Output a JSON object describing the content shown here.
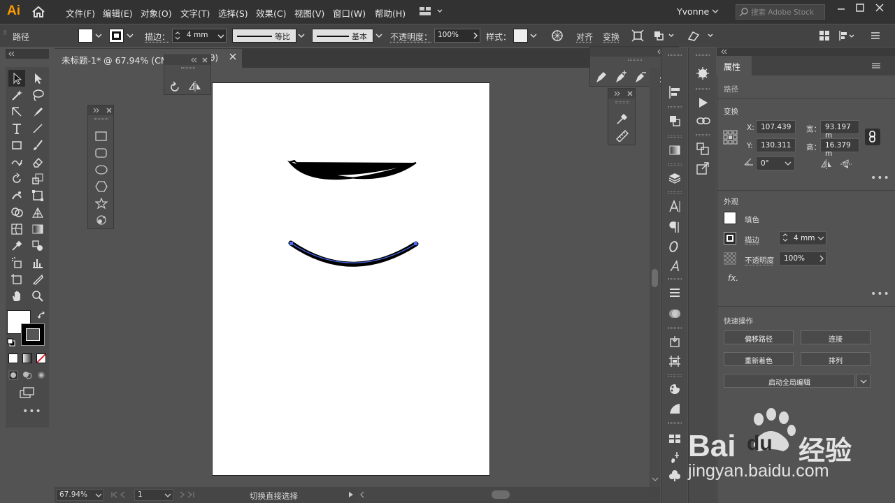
{
  "app": {
    "logo": "Ai"
  },
  "menu": [
    "文件(F)",
    "编辑(E)",
    "对象(O)",
    "文字(T)",
    "选择(S)",
    "效果(C)",
    "视图(V)",
    "窗口(W)",
    "帮助(H)"
  ],
  "user": "Yvonne",
  "stock_search": {
    "placeholder": "搜索 Adobe Stock"
  },
  "control": {
    "object_type": "路径",
    "stroke_label": "描边：",
    "stroke_value": "4 mm",
    "profile_label": "等比",
    "brush_label": "基本",
    "opacity_label": "不透明度：",
    "opacity_value": "100%",
    "style_label": "样式：",
    "align_label": "对齐",
    "transform_label": "变换"
  },
  "document": {
    "tab": "未标题-1* @ 67.94% (CMYK/GPU 预览)",
    "tab_visible": "未标题-1* @ 67.94% (CM",
    "tab_suffix": "θ)"
  },
  "status": {
    "zoom": "67.94%",
    "artboard": "1",
    "tool_hint": "切换直接选择"
  },
  "properties": {
    "tab": "属性",
    "object": "路径",
    "transform_header": "变换",
    "x_label": "X:",
    "x": "107.439",
    "y_label": "Y:",
    "y": "130.311",
    "w_label": "宽：",
    "w": "93.197 m",
    "h_label": "高：",
    "h": "16.379 m",
    "angle": "0°",
    "appearance_header": "外观",
    "fill_label": "填色",
    "stroke_label": "描边",
    "stroke_value": "4 mm",
    "opacity_label": "不透明度",
    "opacity_value": "100%",
    "fx_label": "fx.",
    "quick_header": "快速操作",
    "buttons": [
      "偏移路径",
      "连接",
      "重新着色",
      "排列",
      "启动全局编辑"
    ]
  },
  "watermark": {
    "brand": "Bai",
    "brand2": "经验",
    "url": "jingyan.baidu.com"
  },
  "colors": {
    "accent": "#ff9a00",
    "selection": "#4a6cf7",
    "artboard": "#ffffff"
  }
}
